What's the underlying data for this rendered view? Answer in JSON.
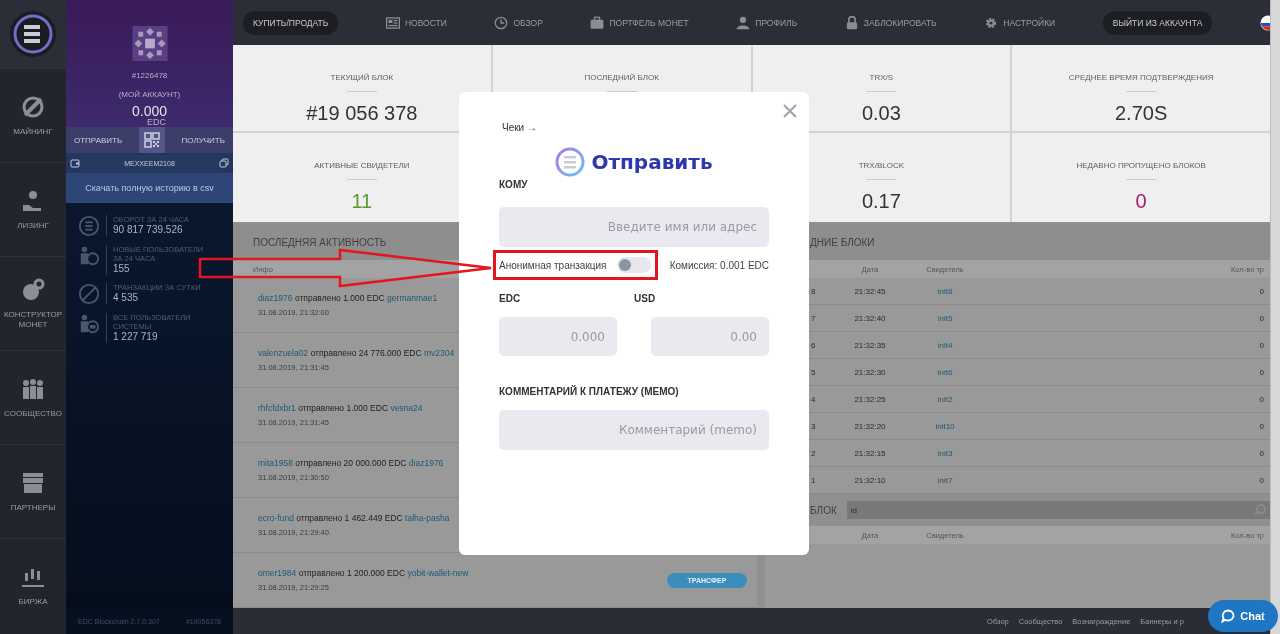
{
  "nav": {
    "items": [
      {
        "label": "МАЙНИНГ"
      },
      {
        "label": "ЛИЗИНГ"
      },
      {
        "label": "КОНСТРУКТОР МОНЕТ"
      },
      {
        "label": "СООБЩЕСТВО"
      },
      {
        "label": "ПАРТНЕРЫ"
      },
      {
        "label": "БИРЖА"
      }
    ]
  },
  "account": {
    "id": "#1226478",
    "caption": "(МОЙ АККАУНТ)",
    "balance": "0.000",
    "currency": "EDC",
    "send": "ОТПРАВИТЬ",
    "receive": "ПОЛУЧИТЬ",
    "address": "MEXXEEM2108",
    "download": "Скачать полную историю в csv",
    "stats": [
      {
        "label": "ОБОРОТ ЗА 24 ЧАСА",
        "value": "90 817 739.526"
      },
      {
        "label": "НОВЫЕ ПОЛЬЗОВАТЕЛИ ЗА 24 ЧАСА",
        "value": "155"
      },
      {
        "label": "ТРАНЗАКЦИИ ЗА СУТКИ",
        "value": "4 535"
      },
      {
        "label": "ВСЕ ПОЛЬЗОВАТЕЛИ СИСТЕМЫ",
        "value": "1 227 719"
      }
    ],
    "version": "EDC Blockchain 2.7.0.307",
    "block": "#19056378"
  },
  "topbar": {
    "items": [
      {
        "kind": "pill",
        "label": "КУПИТЬ/ПРОДАТЬ"
      },
      {
        "kind": "link",
        "label": "НОВОСТИ"
      },
      {
        "kind": "link",
        "label": "ОБЗОР"
      },
      {
        "kind": "link",
        "label": "ПОРТФЕЛЬ МОНЕТ"
      },
      {
        "kind": "link",
        "label": "ПРОФИЛЬ"
      },
      {
        "kind": "link",
        "label": "ЗАБЛОКИРОВАТЬ"
      },
      {
        "kind": "link",
        "label": "НАСТРОЙКИ"
      },
      {
        "kind": "pill",
        "label": "ВЫЙТИ ИЗ АККАУНТА"
      }
    ]
  },
  "stats": [
    {
      "label": "ТЕКУЩИЙ БЛОК",
      "value": "#19 056 378",
      "color": "#333333"
    },
    {
      "label": "ПОСЛЕДНИЙ БЛОК"
    },
    {
      "label": "TRX/S",
      "value": "0.03",
      "color": "#333333"
    },
    {
      "label": "СРЕДНЕЕ ВРЕМЯ ПОДТВЕРЖДЕНИЯ",
      "value": "2.70S",
      "color": "#333333"
    },
    {
      "label": "АКТИВНЫЕ СВИДЕТЕЛИ",
      "value": "11",
      "color": "#5a9a2e"
    },
    {
      "label": "TRX/BLOCK",
      "value": "0.17",
      "color": "#333333"
    },
    {
      "label": "НЕДАВНО ПРОПУЩЕНО БЛОКОВ",
      "value": "0",
      "color": "#a3206e"
    }
  ],
  "activity": {
    "title": "ПОСЛЕДНЯЯ АКТИВНОСТЬ",
    "column": "Инфо",
    "rows": [
      {
        "from": "diaz1976",
        "action": "отправлено 1.000 EDC",
        "to": "germanmae1",
        "time": "31.08.2019, 21:32:00"
      },
      {
        "from": "valenzuela02",
        "action": "отправлено 24 776.000 EDC",
        "to": "mv2304",
        "time": "31.08.2019, 21:31:45"
      },
      {
        "from": "rhfcfdxbr1",
        "action": "отправлено 1.000 EDC",
        "to": "vesna24",
        "time": "31.08.2019, 21:31:45"
      },
      {
        "from": "mita1958",
        "action": "отправлено 20 000.000 EDC",
        "to": "diaz1976",
        "time": "31.08.2019, 21:30:50"
      },
      {
        "from": "ecro-fund",
        "action": "отправлено 1 462.449 EDC",
        "to": "talha-pasha",
        "time": "31.08.2019, 21:29:40"
      },
      {
        "from": "omer1984",
        "action": "отправлено 1 200.000 EDC",
        "to": "yobit-wallet-new",
        "time": "31.08.2019, 21:29:25",
        "tag": "ТРАНСФЕР"
      }
    ]
  },
  "blocks": {
    "title": "ДНИЕ БЛОКИ",
    "columns": [
      "Дата",
      "Свидетель",
      "Кол-во тр"
    ],
    "rows": [
      {
        "column_1": "8",
        "date": "21:32:45",
        "witness": "init8",
        "count": "0"
      },
      {
        "column_1": "7",
        "date": "21:32:40",
        "witness": "init5",
        "count": "0"
      },
      {
        "column_1": "6",
        "date": "21:32:35",
        "witness": "init4",
        "count": "0"
      },
      {
        "column_1": "5",
        "date": "21:32:30",
        "witness": "init6",
        "count": "0"
      },
      {
        "column_1": "4",
        "date": "21:32:25",
        "witness": "init2",
        "count": "0"
      },
      {
        "column_1": "3",
        "date": "21:32:20",
        "witness": "init10",
        "count": "0"
      },
      {
        "column_1": "2",
        "date": "21:32:15",
        "witness": "init3",
        "count": "0"
      },
      {
        "column_1": "1",
        "date": "21:32:10",
        "witness": "init7",
        "count": "0"
      }
    ]
  },
  "block_search": {
    "label": "БЛОК",
    "placeholder": "id",
    "columns": [
      "Дата",
      "Свидетель",
      "Кол-во тр"
    ]
  },
  "footer": {
    "links": [
      "Обзор",
      "Сообщество",
      "Вознаграждение",
      "Баннеры и р"
    ]
  },
  "chat": {
    "label": "Chat"
  },
  "modal": {
    "link": "Чеки →",
    "title": "Отправить",
    "to_label": "КОМУ",
    "to_placeholder": "Введите имя или адрес",
    "anonymous": {
      "label": "Анонимная транзакция",
      "on": false
    },
    "fee": "Комиссия: 0.001 EDC",
    "edc_label": "EDC",
    "edc_placeholder": "0.000",
    "usd_label": "USD",
    "usd_placeholder": "0.00",
    "memo_label": "КОММЕНТАРИЙ К ПЛАТЕЖУ (MEMO)",
    "memo_placeholder": "Комментарий (memo)"
  }
}
